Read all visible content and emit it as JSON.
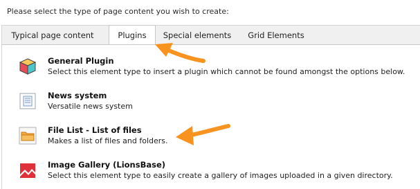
{
  "prompt": "Please select the type of page content you wish to create:",
  "tabs": [
    {
      "label": "Typical page content",
      "active": false
    },
    {
      "label": "Plugins",
      "active": true
    },
    {
      "label": "Special elements",
      "active": false
    },
    {
      "label": "Grid Elements",
      "active": false
    }
  ],
  "items": [
    {
      "title": "General Plugin",
      "description": "Select this element type to insert a plugin which cannot be found amongst the options below.",
      "icon": "cube-icon"
    },
    {
      "title": "News system",
      "description": "Versatile news system",
      "icon": "news-document-icon"
    },
    {
      "title": "File List - List of files",
      "description": "Makes a list of files and folders.",
      "icon": "folder-icon"
    },
    {
      "title": "Image Gallery (LionsBase)",
      "description": "Select this element type to easily create a gallery of images uploaded in a given directory.",
      "icon": "gallery-icon"
    }
  ],
  "colors": {
    "annotation_arrow": "#f7931e",
    "tab_bar": "#f0f0f0",
    "cube_top": "#f7c95a",
    "cube_left": "#e84c5b",
    "cube_right": "#4cc6c9",
    "folder": "#f4a93b",
    "gallery": "#e0313a"
  },
  "annotations": [
    {
      "name": "arrow-to-plugins-tab",
      "points_to": "Plugins"
    },
    {
      "name": "arrow-to-file-list",
      "points_to": "File List - List of files"
    }
  ]
}
